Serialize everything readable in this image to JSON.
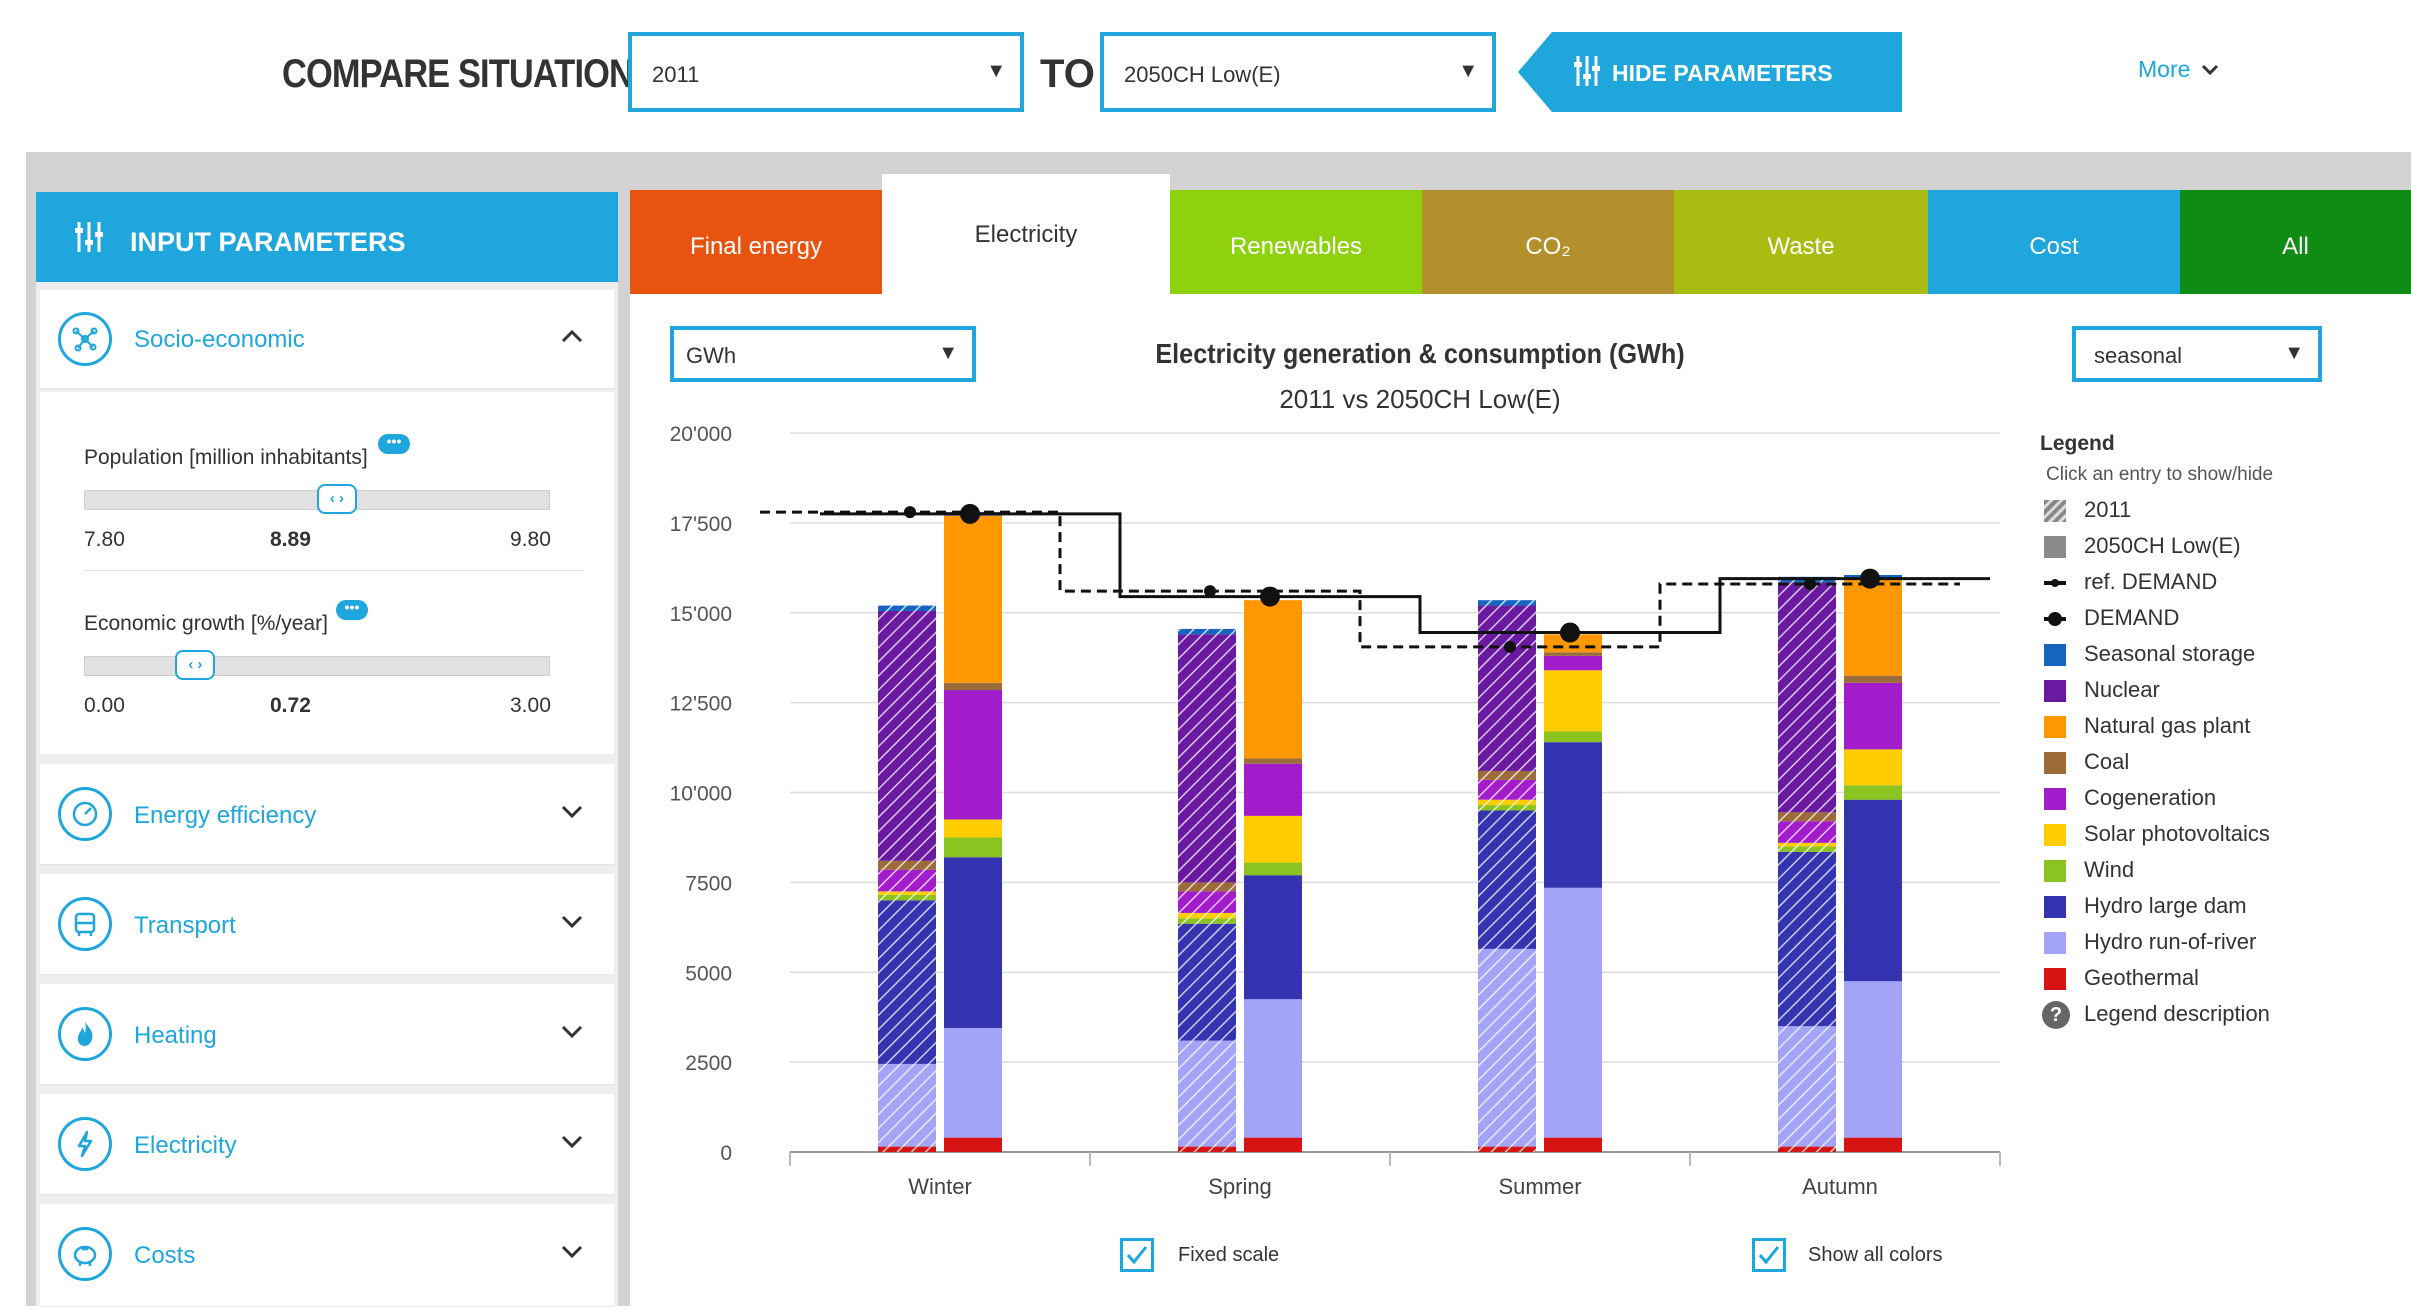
{
  "header": {
    "compare_label": "COMPARE SITUATION",
    "situation_a": "2011",
    "to_label": "TO",
    "situation_b": "2050CH Low(E)",
    "hide_params_label": "HIDE PARAMETERS",
    "more_label": "More"
  },
  "sidebar": {
    "title": "INPUT PARAMETERS",
    "sections": [
      {
        "label": "Socio-economic",
        "icon": "network-icon",
        "expanded": true
      },
      {
        "label": "Energy efficiency",
        "icon": "gauge-icon"
      },
      {
        "label": "Transport",
        "icon": "bus-icon"
      },
      {
        "label": "Heating",
        "icon": "flame-icon"
      },
      {
        "label": "Electricity",
        "icon": "lightning-icon"
      },
      {
        "label": "Costs",
        "icon": "piggy-bank-icon"
      }
    ],
    "population": {
      "label": "Population [million inhabitants]",
      "min": "7.80",
      "value": "8.89",
      "max": "9.80",
      "fraction": 0.545
    },
    "growth": {
      "label": "Economic growth [%/year]",
      "min": "0.00",
      "value": "0.72",
      "max": "3.00",
      "fraction": 0.24
    }
  },
  "tabs": [
    {
      "label": "Final energy",
      "color": "#e8530f"
    },
    {
      "label": "Electricity",
      "color": "#ffffff",
      "active": true
    },
    {
      "label": "Renewables",
      "color": "#8dd10f"
    },
    {
      "label": "CO₂",
      "color": "#b3902b"
    },
    {
      "label": "Waste",
      "color": "#a9bc12"
    },
    {
      "label": "Cost",
      "color": "#1ea6dd"
    },
    {
      "label": "All",
      "color": "#0f8c14"
    }
  ],
  "controls": {
    "unit": "GWh",
    "period": "seasonal",
    "fixed_scale_label": "Fixed scale",
    "show_colors_label": "Show all colors"
  },
  "chart_data": {
    "type": "bar",
    "title": "Electricity generation & consumption (GWh)",
    "subtitle": "2011 vs 2050CH Low(E)",
    "categories": [
      "Winter",
      "Spring",
      "Summer",
      "Autumn"
    ],
    "y_ticks": [
      "0",
      "2500",
      "5000",
      "7500",
      "10'000",
      "12'500",
      "15'000",
      "17'500",
      "20'000"
    ],
    "ylim": [
      0,
      20000
    ],
    "series_order": [
      "Geothermal",
      "Hydro run-of-river",
      "Hydro large dam",
      "Wind",
      "Solar photovoltaics",
      "Cogeneration",
      "Coal",
      "Natural gas plant",
      "Nuclear",
      "Seasonal storage"
    ],
    "colors": {
      "Seasonal storage": "#1565c0",
      "Nuclear": "#6a1aa0",
      "Natural gas plant": "#ff9800",
      "Coal": "#9c6b3a",
      "Cogeneration": "#a21ccc",
      "Solar photovoltaics": "#ffcc00",
      "Wind": "#8bc320",
      "Hydro large dam": "#3434b0",
      "Hydro run-of-river": "#a3a3f7",
      "Geothermal": "#d71414"
    },
    "stacks": {
      "2011": {
        "Winter": {
          "Geothermal": 150,
          "Hydro run-of-river": 2300,
          "Hydro large dam": 4550,
          "Wind": 150,
          "Solar photovoltaics": 100,
          "Cogeneration": 600,
          "Coal": 250,
          "Natural gas plant": 0,
          "Nuclear": 6950,
          "Seasonal storage": 150
        },
        "Spring": {
          "Geothermal": 150,
          "Hydro run-of-river": 2950,
          "Hydro large dam": 3250,
          "Wind": 150,
          "Solar photovoltaics": 150,
          "Cogeneration": 600,
          "Coal": 250,
          "Natural gas plant": 0,
          "Nuclear": 6900,
          "Seasonal storage": 150
        },
        "Summer": {
          "Geothermal": 150,
          "Hydro run-of-river": 5500,
          "Hydro large dam": 3850,
          "Wind": 150,
          "Solar photovoltaics": 150,
          "Cogeneration": 550,
          "Coal": 250,
          "Natural gas plant": 0,
          "Nuclear": 4600,
          "Seasonal storage": 150
        },
        "Autumn": {
          "Geothermal": 150,
          "Hydro run-of-river": 3350,
          "Hydro large dam": 4850,
          "Wind": 150,
          "Solar photovoltaics": 100,
          "Cogeneration": 600,
          "Coal": 250,
          "Natural gas plant": 0,
          "Nuclear": 6400,
          "Seasonal storage": 150
        }
      },
      "2050CH Low(E)": {
        "Winter": {
          "Geothermal": 400,
          "Hydro run-of-river": 3050,
          "Hydro large dam": 4750,
          "Wind": 550,
          "Solar photovoltaics": 500,
          "Cogeneration": 3600,
          "Coal": 200,
          "Natural gas plant": 4650,
          "Nuclear": 0,
          "Seasonal storage": 100
        },
        "Spring": {
          "Geothermal": 400,
          "Hydro run-of-river": 3850,
          "Hydro large dam": 3450,
          "Wind": 350,
          "Solar photovoltaics": 1300,
          "Cogeneration": 1450,
          "Coal": 150,
          "Natural gas plant": 4400,
          "Nuclear": 0,
          "Seasonal storage": 0
        },
        "Summer": {
          "Geothermal": 400,
          "Hydro run-of-river": 6950,
          "Hydro large dam": 4050,
          "Wind": 300,
          "Solar photovoltaics": 1700,
          "Cogeneration": 400,
          "Coal": 100,
          "Natural gas plant": 500,
          "Nuclear": 0,
          "Seasonal storage": 0
        },
        "Autumn": {
          "Geothermal": 400,
          "Hydro run-of-river": 4350,
          "Hydro large dam": 5050,
          "Wind": 400,
          "Solar photovoltaics": 1000,
          "Cogeneration": 1850,
          "Coal": 200,
          "Natural gas plant": 2700,
          "Nuclear": 0,
          "Seasonal storage": 100
        }
      }
    },
    "ref_demand": [
      17800,
      15600,
      14050,
      15800
    ],
    "demand": [
      17750,
      15450,
      14450,
      15950
    ],
    "legend": {
      "title": "Legend",
      "hint": "Click an entry to show/hide",
      "items": [
        {
          "label": "2011",
          "kind": "hatch"
        },
        {
          "label": "2050CH Low(E)",
          "kind": "gray"
        },
        {
          "label": "ref. DEMAND",
          "kind": "dash"
        },
        {
          "label": "DEMAND",
          "kind": "line"
        },
        {
          "label": "Seasonal storage",
          "kind": "color"
        },
        {
          "label": "Nuclear",
          "kind": "color"
        },
        {
          "label": "Natural gas plant",
          "kind": "color"
        },
        {
          "label": "Coal",
          "kind": "color"
        },
        {
          "label": "Cogeneration",
          "kind": "color"
        },
        {
          "label": "Solar photovoltaics",
          "kind": "color"
        },
        {
          "label": "Wind",
          "kind": "color"
        },
        {
          "label": "Hydro large dam",
          "kind": "color"
        },
        {
          "label": "Hydro run-of-river",
          "kind": "color"
        },
        {
          "label": "Geothermal",
          "kind": "color"
        },
        {
          "label": "Legend description",
          "kind": "help"
        }
      ]
    }
  }
}
